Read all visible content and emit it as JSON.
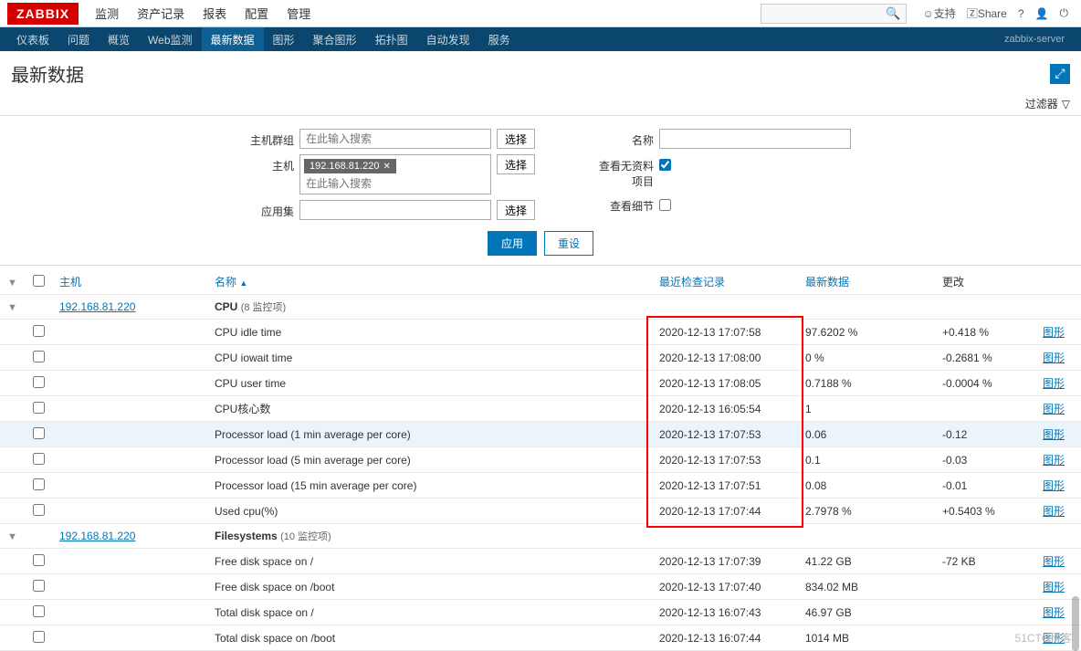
{
  "logo": "ZABBIX",
  "topnav": [
    "监测",
    "资产记录",
    "报表",
    "配置",
    "管理"
  ],
  "topnav_active": 0,
  "top_right": {
    "support": "支持",
    "share": "Share"
  },
  "subnav": [
    "仪表板",
    "问题",
    "概览",
    "Web监测",
    "最新数据",
    "图形",
    "聚合图形",
    "拓扑图",
    "自动发现",
    "服务"
  ],
  "subnav_active": 4,
  "server_label": "zabbix-server",
  "page_title": "最新数据",
  "filter_label": "过滤器",
  "filters": {
    "hostgroup_label": "主机群组",
    "hostgroup_placeholder": "在此输入搜索",
    "host_label": "主机",
    "host_tag": "192.168.81.220",
    "host_placeholder": "在此输入搜索",
    "appset_label": "应用集",
    "select_btn": "选择",
    "name_label": "名称",
    "show_noinfo_label": "查看无资料项目",
    "show_noinfo_checked": true,
    "show_detail_label": "查看细节",
    "show_detail_checked": false,
    "apply": "应用",
    "reset": "重设"
  },
  "columns": {
    "expand": "▼",
    "host": "主机",
    "name": "名称",
    "last_check": "最近检查记录",
    "latest": "最新数据",
    "change": "更改",
    "sort_ind": "▲"
  },
  "groups": [
    {
      "expanded": true,
      "host": "192.168.81.220",
      "group_name": "CPU",
      "group_count": "(8 监控项)",
      "items": [
        {
          "name": "CPU idle time",
          "time": "2020-12-13 17:07:58",
          "latest": "97.6202 %",
          "change": "+0.418 %",
          "action": "图形",
          "hl": false
        },
        {
          "name": "CPU iowait time",
          "time": "2020-12-13 17:08:00",
          "latest": "0 %",
          "change": "-0.2681 %",
          "action": "图形",
          "hl": false
        },
        {
          "name": "CPU user time",
          "time": "2020-12-13 17:08:05",
          "latest": "0.7188 %",
          "change": "-0.0004 %",
          "action": "图形",
          "hl": false
        },
        {
          "name": "CPU核心数",
          "time": "2020-12-13 16:05:54",
          "latest": "1",
          "change": "",
          "action": "图形",
          "hl": false
        },
        {
          "name": "Processor load (1 min average per core)",
          "time": "2020-12-13 17:07:53",
          "latest": "0.06",
          "change": "-0.12",
          "action": "图形",
          "hl": true
        },
        {
          "name": "Processor load (5 min average per core)",
          "time": "2020-12-13 17:07:53",
          "latest": "0.1",
          "change": "-0.03",
          "action": "图形",
          "hl": false
        },
        {
          "name": "Processor load (15 min average per core)",
          "time": "2020-12-13 17:07:51",
          "latest": "0.08",
          "change": "-0.01",
          "action": "图形",
          "hl": false
        },
        {
          "name": "Used cpu(%)",
          "time": "2020-12-13 17:07:44",
          "latest": "2.7978 %",
          "change": "+0.5403 %",
          "action": "图形",
          "hl": false
        }
      ]
    },
    {
      "expanded": true,
      "host": "192.168.81.220",
      "group_name": "Filesystems",
      "group_count": "(10 监控项)",
      "items": [
        {
          "name": "Free disk space on /",
          "time": "2020-12-13 17:07:39",
          "latest": "41.22 GB",
          "change": "-72 KB",
          "action": "图形",
          "hl": false
        },
        {
          "name": "Free disk space on /boot",
          "time": "2020-12-13 17:07:40",
          "latest": "834.02 MB",
          "change": "",
          "action": "图形",
          "hl": false
        },
        {
          "name": "Total disk space on /",
          "time": "2020-12-13 16:07:43",
          "latest": "46.97 GB",
          "change": "",
          "action": "图形",
          "hl": false
        },
        {
          "name": "Total disk space on /boot",
          "time": "2020-12-13 16:07:44",
          "latest": "1014 MB",
          "change": "",
          "action": "图形",
          "hl": false
        }
      ]
    }
  ]
}
